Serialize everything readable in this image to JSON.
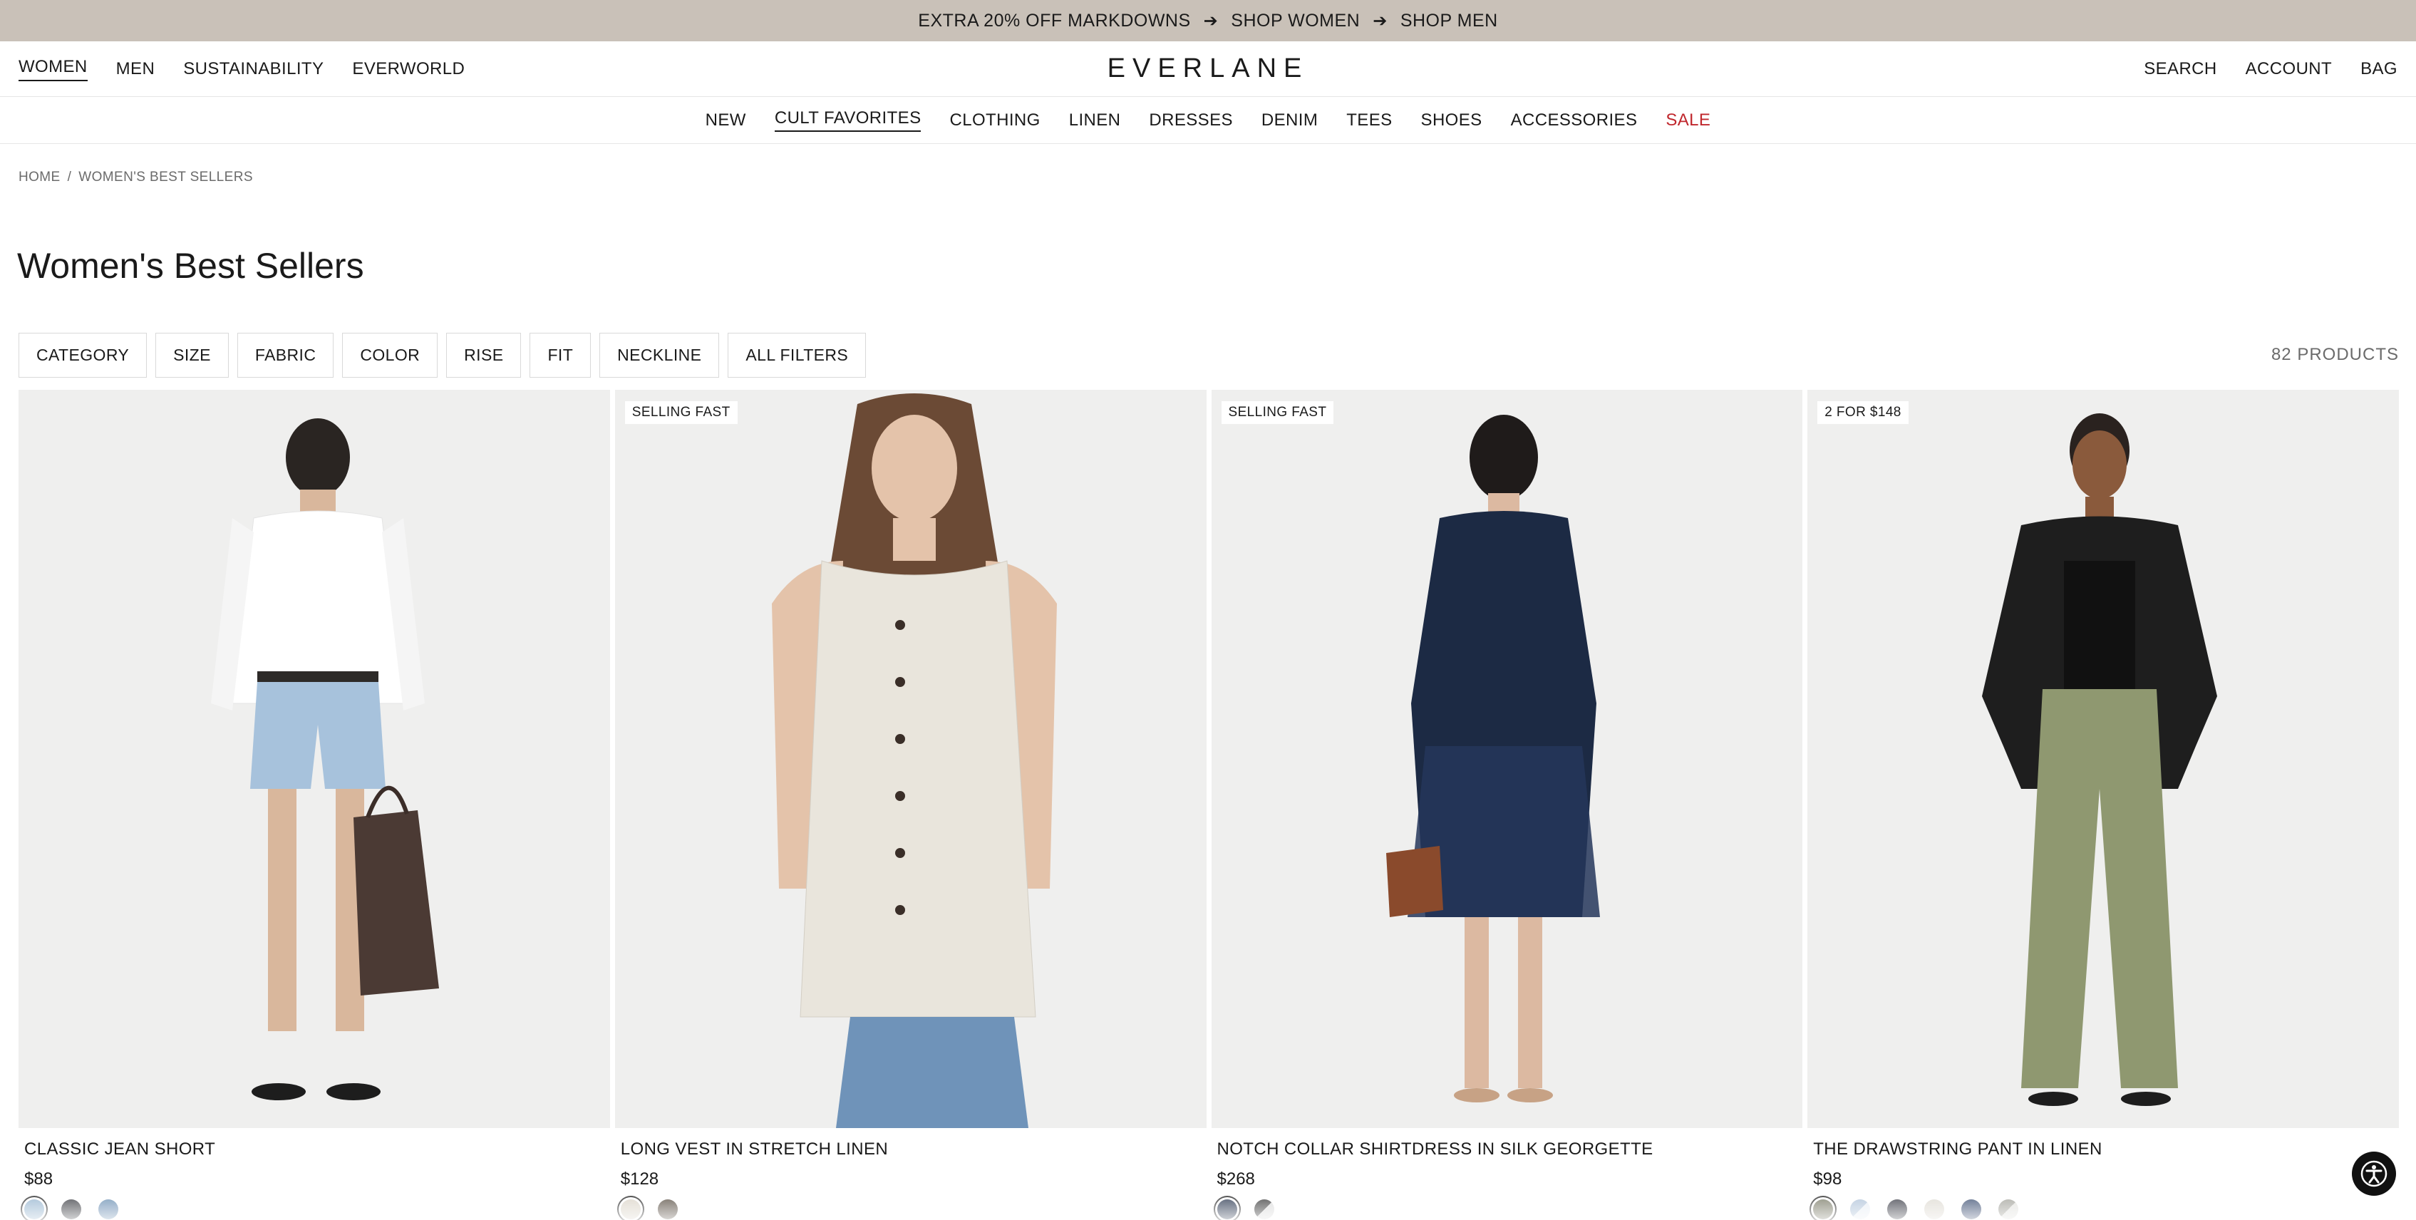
{
  "promo": {
    "text": "EXTRA 20% OFF MARKDOWNS",
    "link_women": "SHOP WOMEN",
    "link_men": "SHOP MEN",
    "arrow": "➔"
  },
  "header": {
    "nav": [
      "WOMEN",
      "MEN",
      "SUSTAINABILITY",
      "EVERWORLD"
    ],
    "logo": "EVERLANE",
    "search": "SEARCH",
    "account": "ACCOUNT",
    "bag": "BAG"
  },
  "catnav": [
    "NEW",
    "CULT FAVORITES",
    "CLOTHING",
    "LINEN",
    "DRESSES",
    "DENIM",
    "TEES",
    "SHOES",
    "ACCESSORIES",
    "SALE"
  ],
  "breadcrumb": {
    "home": "HOME",
    "sep": "/",
    "current": "WOMEN'S BEST SELLERS"
  },
  "title": "Women's Best Sellers",
  "filters": [
    "CATEGORY",
    "SIZE",
    "FABRIC",
    "COLOR",
    "RISE",
    "FIT",
    "NECKLINE",
    "ALL FILTERS"
  ],
  "product_count": "82 PRODUCTS",
  "products": [
    {
      "name": "CLASSIC JEAN SHORT",
      "price": "$88",
      "badge": "",
      "swatches": [
        "#8fb0cc",
        "#2b2d33",
        "#5f86ad"
      ]
    },
    {
      "name": "LONG VEST IN STRETCH LINEN",
      "price": "$128",
      "badge": "SELLING FAST",
      "swatches": [
        "#d8d1c4",
        "#4d4236"
      ]
    },
    {
      "name": "NOTCH COLLAR SHIRTDRESS IN SILK GEORGETTE",
      "price": "$268",
      "badge": "SELLING FAST",
      "swatches": [
        "#1c2a44",
        "#8a8a8a"
      ]
    },
    {
      "name": "THE DRAWSTRING PANT IN LINEN",
      "price": "$98",
      "badge": "2 FOR $148",
      "swatches": [
        "#6f705b",
        "#a9bed6",
        "#2b2d38",
        "#dcd8cf",
        "#2e4268",
        "#9a9a92"
      ]
    }
  ],
  "colors": {
    "promo_bg": "#c9c1b8",
    "sale": "#c0272d",
    "image_bg": "#efefee"
  }
}
